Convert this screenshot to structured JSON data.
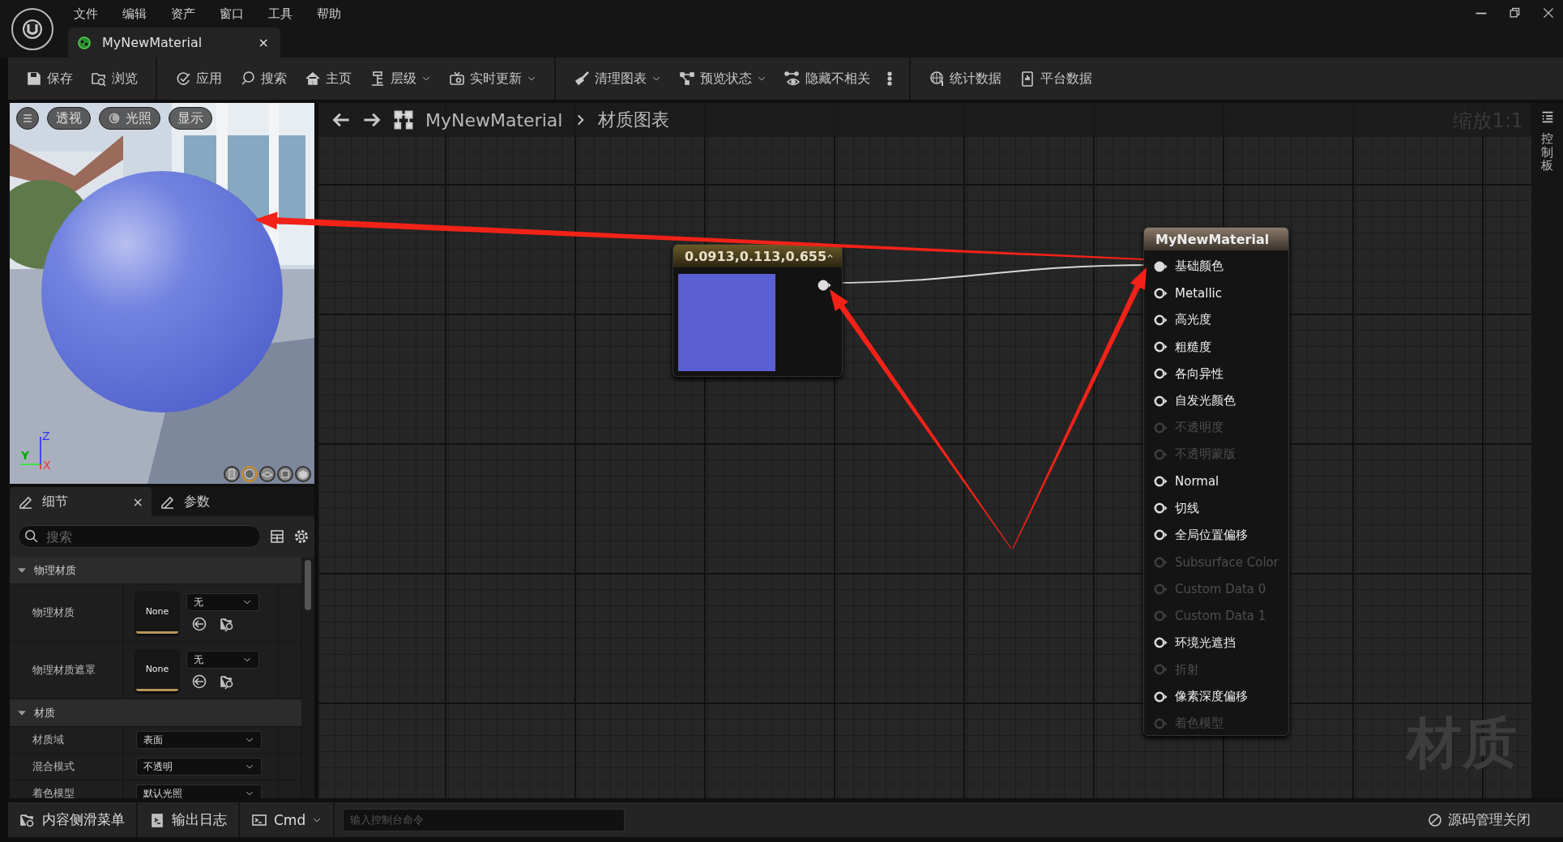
{
  "menu": [
    "文件",
    "编辑",
    "资产",
    "窗口",
    "工具",
    "帮助"
  ],
  "document_tab": {
    "title": "MyNewMaterial",
    "close": "×",
    "selected": true
  },
  "toolbar": {
    "groups": [
      [
        {
          "label": "保存",
          "dropdown": false
        },
        {
          "label": "浏览",
          "dropdown": false
        }
      ],
      [
        {
          "label": "应用",
          "dropdown": false
        },
        {
          "label": "搜索",
          "dropdown": false
        },
        {
          "label": "主页",
          "dropdown": false
        },
        {
          "label": "层级",
          "dropdown": true
        },
        {
          "label": "实时更新",
          "dropdown": true
        }
      ],
      [
        {
          "label": "清理图表",
          "dropdown": true
        },
        {
          "label": "预览状态",
          "dropdown": true
        },
        {
          "label": "隐藏不相关",
          "dropdown": false
        }
      ],
      [
        {
          "label": "统计数据",
          "dropdown": false
        },
        {
          "label": "平台数据",
          "dropdown": false
        }
      ]
    ]
  },
  "viewport": {
    "buttons": [
      {
        "label": "透视"
      },
      {
        "label": "光照"
      },
      {
        "label": "显示"
      }
    ],
    "axes": [
      "Z",
      "Y",
      "X"
    ],
    "preview_shapes": [
      {
        "selected": false
      },
      {
        "selected": true
      },
      {
        "selected": false
      },
      {
        "selected": false
      },
      {
        "selected": false
      }
    ]
  },
  "details": {
    "tabs": [
      {
        "label": "细节",
        "selected": true,
        "close": "×"
      },
      {
        "label": "参数",
        "selected": false
      }
    ],
    "search": {
      "placeholder": "搜索"
    },
    "sections": [
      {
        "title": "物理材质",
        "expanded": true,
        "rows": [
          {
            "kind": "asset",
            "label": "物理材质",
            "thumbnail": "None",
            "value": "无"
          },
          {
            "kind": "asset",
            "label": "物理材质遮罩",
            "thumbnail": "None",
            "value": "无"
          }
        ]
      },
      {
        "title": "材质",
        "expanded": true,
        "rows": [
          {
            "kind": "dropdown",
            "label": "材质域",
            "value": "表面"
          },
          {
            "kind": "dropdown",
            "label": "混合模式",
            "value": "不透明"
          },
          {
            "kind": "dropdown",
            "label": "着色模型",
            "value": "默认光照"
          }
        ]
      }
    ]
  },
  "graph": {
    "breadcrumb": [
      "MyNewMaterial",
      "材质图表"
    ],
    "zoom": "缩放1:1",
    "watermark": "材质",
    "constant_node": {
      "title": "0.0913,0.113,0.655"
    },
    "material_node": {
      "title": "MyNewMaterial",
      "pins": [
        {
          "label": "基础颜色",
          "enabled": true,
          "connected": true
        },
        {
          "label": "Metallic",
          "enabled": true,
          "connected": false
        },
        {
          "label": "高光度",
          "enabled": true,
          "connected": false
        },
        {
          "label": "粗糙度",
          "enabled": true,
          "connected": false
        },
        {
          "label": "各向异性",
          "enabled": true,
          "connected": false
        },
        {
          "label": "自发光颜色",
          "enabled": true,
          "connected": false
        },
        {
          "label": "不透明度",
          "enabled": false,
          "connected": false
        },
        {
          "label": "不透明蒙版",
          "enabled": false,
          "connected": false
        },
        {
          "label": "Normal",
          "enabled": true,
          "connected": false
        },
        {
          "label": "切线",
          "enabled": true,
          "connected": false
        },
        {
          "label": "全局位置偏移",
          "enabled": true,
          "connected": false
        },
        {
          "label": "Subsurface Color",
          "enabled": false,
          "connected": false
        },
        {
          "label": "Custom Data 0",
          "enabled": false,
          "connected": false
        },
        {
          "label": "Custom Data 1",
          "enabled": false,
          "connected": false
        },
        {
          "label": "环境光遮挡",
          "enabled": true,
          "connected": false
        },
        {
          "label": "折射",
          "enabled": false,
          "connected": false
        },
        {
          "label": "像素深度偏移",
          "enabled": true,
          "connected": false
        },
        {
          "label": "着色模型",
          "enabled": false,
          "connected": false
        }
      ]
    }
  },
  "side_tab": "控制板",
  "bottom_bar": {
    "buttons": [
      "内容侧滑菜单",
      "输出日志"
    ],
    "cmd": "Cmd",
    "console": {
      "placeholder": "输入控制台命令"
    },
    "source_control": "源码管理关闭"
  }
}
